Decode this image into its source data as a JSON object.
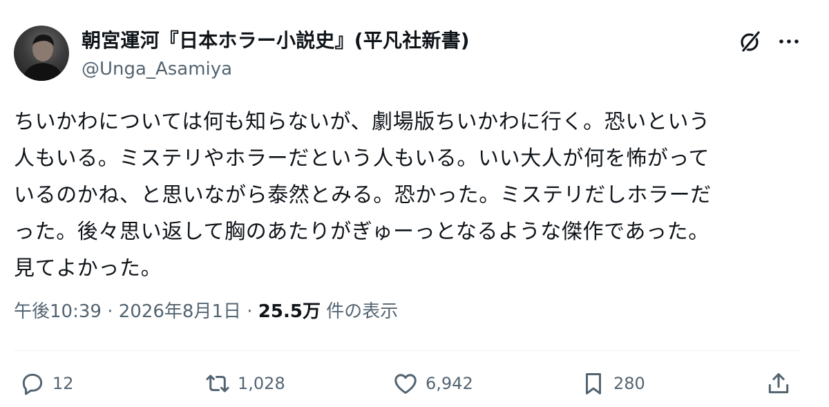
{
  "author": {
    "display_name": "朝宮運河『日本ホラー小説史』(平凡社新書)",
    "handle": "@Unga_Asamiya"
  },
  "header_icons": [
    "grok-icon",
    "more-icon"
  ],
  "body_lines": [
    "ちいかわについては何も知らないが、劇場版ちいかわに行く。恐いという",
    "人もいる。ミステリやホラーだという人もいる。いい大人が何を怖がって",
    "いるのかね、と思いながら泰然とみる。恐かった。ミステリだしホラーだ",
    "った。後々思い返して胸のあたりがぎゅーっとなるような傑作であった。",
    "見てよかった。"
  ],
  "meta": {
    "time": "午後10:39",
    "separator": " · ",
    "date": "2026年8月1日",
    "views_count": "25.5万",
    "views_label": " 件の表示"
  },
  "actions": {
    "reply_count": "12",
    "retweet_count": "1,028",
    "like_count": "6,942",
    "bookmark_count": "280"
  },
  "colors": {
    "text": "#0f1419",
    "secondary": "#536471",
    "divider": "#eff3f4"
  }
}
